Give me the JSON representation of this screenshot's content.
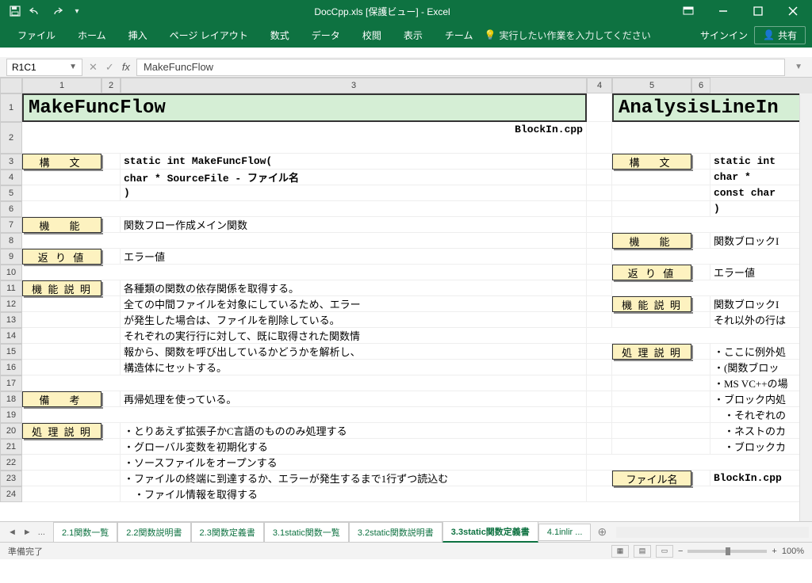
{
  "title": "DocCpp.xls  [保護ビュー] - Excel",
  "ribbon": {
    "tabs": [
      "ファイル",
      "ホーム",
      "挿入",
      "ページ レイアウト",
      "数式",
      "データ",
      "校閲",
      "表示",
      "チーム"
    ],
    "tell_me": "実行したい作業を入力してください",
    "sign_in": "サインイン",
    "share": "共有"
  },
  "name_box": "R1C1",
  "formula": "MakeFuncFlow",
  "columns": [
    "1",
    "2",
    "3",
    "4",
    "5",
    "6"
  ],
  "rows": [
    "1",
    "2",
    "3",
    "4",
    "5",
    "6",
    "7",
    "8",
    "9",
    "10",
    "11",
    "12",
    "13",
    "14",
    "15",
    "16",
    "17",
    "18",
    "19",
    "20",
    "21",
    "22",
    "23",
    "24"
  ],
  "left": {
    "title": "MakeFuncFlow",
    "file": "BlockIn.cpp",
    "syntax_hdr": "構　文",
    "syntax": [
      "static int MakeFuncFlow(",
      "  char * SourceFile   - ファイル名",
      "  )"
    ],
    "func_hdr": "機　能",
    "func": "関数フロー作成メイン関数",
    "ret_hdr": "返 り 値",
    "ret": "エラー値",
    "desc_hdr": "機 能 説 明",
    "desc": [
      "各種類の関数の依存関係を取得する。",
      "全ての中間ファイルを対象にしているため、エラー",
      "が発生した場合は、ファイルを削除している。",
      "それぞれの実行行に対して、既に取得された関数情",
      "報から、関数を呼び出しているかどうかを解析し、",
      "構造体にセットする。"
    ],
    "note_hdr": "備　考",
    "note": "再帰処理を使っている。",
    "proc_hdr": "処 理 説 明",
    "proc": [
      "・とりあえず拡張子かC言語のもののみ処理する",
      "・グローバル変数を初期化する",
      "・ソースファイルをオープンする",
      "・ファイルの終端に到達するか、エラーが発生するまで1行ずつ読込む",
      "　・ファイル情報を取得する"
    ]
  },
  "right": {
    "title": "AnalysisLineIn",
    "syntax_hdr": "構　文",
    "syntax": [
      "static int",
      "  char *",
      "  const char",
      "  )"
    ],
    "func_hdr": "機　能",
    "func": "関数ブロックI",
    "ret_hdr": "返 り 値",
    "ret": "エラー値",
    "desc_hdr": "機 能 説 明",
    "desc": [
      "関数ブロックI",
      "それ以外の行は"
    ],
    "proc_hdr": "処 理 説 明",
    "proc": [
      "・ここに例外処",
      "・(関数ブロッ",
      "・MS VC++の場",
      "・ブロック内処",
      "　・それぞれの",
      "　・ネストのカ",
      "　・ブロックカ"
    ],
    "file_hdr": "ファイル名",
    "file": "BlockIn.cpp"
  },
  "sheets": {
    "nav_first": "◄",
    "nav_prev": "‹",
    "ellipsis": "...",
    "tabs": [
      "2.1関数一覧",
      "2.2関数説明書",
      "2.3関数定義書",
      "3.1static関数一覧",
      "3.2static関数説明書",
      "3.3static関数定義書",
      "4.1inlir ..."
    ],
    "active_index": 5
  },
  "status": {
    "ready": "準備完了",
    "zoom": "100%"
  }
}
